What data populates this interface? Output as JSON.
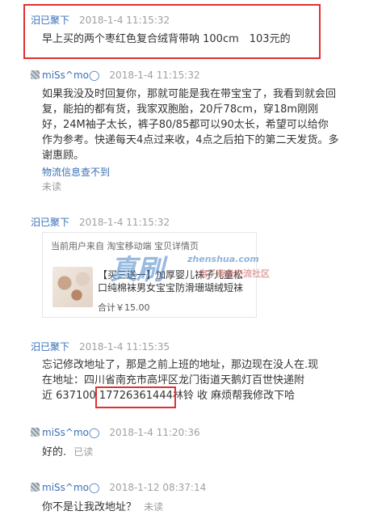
{
  "messages": [
    {
      "sender": "汨已聚下",
      "time": "2018-1-4 11:15:32",
      "lines": [
        "早上买的两个枣红色复合绒背带呐 100cm　103元的"
      ]
    },
    {
      "sender": "miSs^mo◯",
      "time": "2018-1-4 11:15:32",
      "lines": [
        "如果我没及时回复你，那就可能是我在带宝宝了，我看到就会回",
        "复，能拍的都有货，我家双胞胎，20斤78cm，穿18m刚刚",
        "好，24M袖子太长，裤子80/85都可以90太长，希望可以给你",
        "作为参考。快递每天4点过来收，4点之后拍下的第二天发货。多",
        "谢惠顾。"
      ],
      "link": "物流信息查不到",
      "status": "未读"
    },
    {
      "sender": "汨已聚下",
      "time": "2018-1-4 11:15:32",
      "card": {
        "header": "当前用户来自 淘宝移动端 宝贝详情页",
        "title_line1": "【买三送一】加厚婴儿袜子儿童松",
        "title_line2": "口纯棉袜男女宝宝防滑珊瑚绒短袜",
        "price": "合计￥15.00"
      }
    },
    {
      "sender": "汨已聚下",
      "time": "2018-1-4 11:15:35",
      "lines": [
        "忘记修改地址了，那是之前上班的地址，那边现在没人在.现",
        "在地址：四川省南充市高坪区龙门街道天鹅灯百世快递附",
        "近 637100 17726361444林铃 收 麻烦帮我修改下哈"
      ]
    },
    {
      "sender": "miSs^mo◯",
      "time": "2018-1-4 11:20:36",
      "text": "好的.",
      "status": "已读"
    },
    {
      "sender": "miSs^mo◯",
      "time": "2018-1-12 08:37:14",
      "text": "你不是让我改地址？",
      "status": "未读"
    }
  ],
  "watermark": {
    "main": "真刷",
    "domain": "zhenshua.com",
    "tagline": "电子商务交流社区"
  },
  "colors": {
    "highlight_border": "#e03030",
    "link": "#3a6fb7",
    "timestamp": "#a0a0a0"
  }
}
